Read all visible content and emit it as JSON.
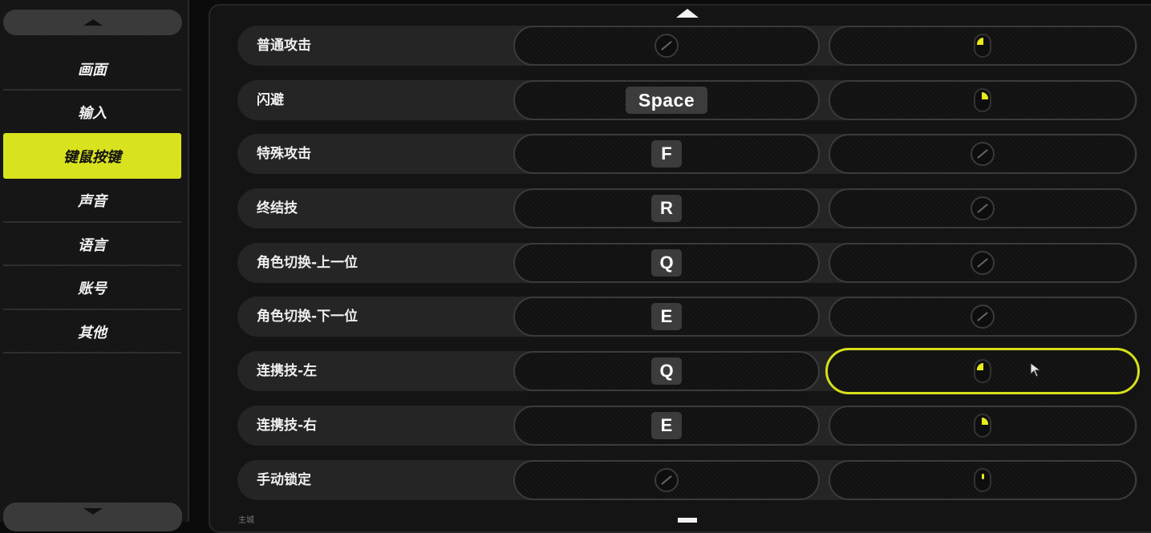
{
  "sidebar": {
    "items": [
      {
        "label": "画面",
        "active": false
      },
      {
        "label": "输入",
        "active": false
      },
      {
        "label": "键鼠按键",
        "active": true
      },
      {
        "label": "声音",
        "active": false
      },
      {
        "label": "语言",
        "active": false
      },
      {
        "label": "账号",
        "active": false
      },
      {
        "label": "其他",
        "active": false
      }
    ]
  },
  "bindings": [
    {
      "action": "普通攻击",
      "keyboard": "",
      "mouse": "left"
    },
    {
      "action": "闪避",
      "keyboard": "Space",
      "mouse": "right"
    },
    {
      "action": "特殊攻击",
      "keyboard": "F",
      "mouse": ""
    },
    {
      "action": "终结技",
      "keyboard": "R",
      "mouse": ""
    },
    {
      "action": "角色切换-上一位",
      "keyboard": "Q",
      "mouse": ""
    },
    {
      "action": "角色切换-下一位",
      "keyboard": "E",
      "mouse": ""
    },
    {
      "action": "连携技-左",
      "keyboard": "Q",
      "mouse": "left"
    },
    {
      "action": "连携技-右",
      "keyboard": "E",
      "mouse": "right"
    },
    {
      "action": "手动锁定",
      "keyboard": "",
      "mouse": "middle"
    }
  ],
  "cutoff_label": "主城",
  "colors": {
    "accent": "#d9e21e",
    "background": "#0b0b0b",
    "row": "#252525"
  }
}
